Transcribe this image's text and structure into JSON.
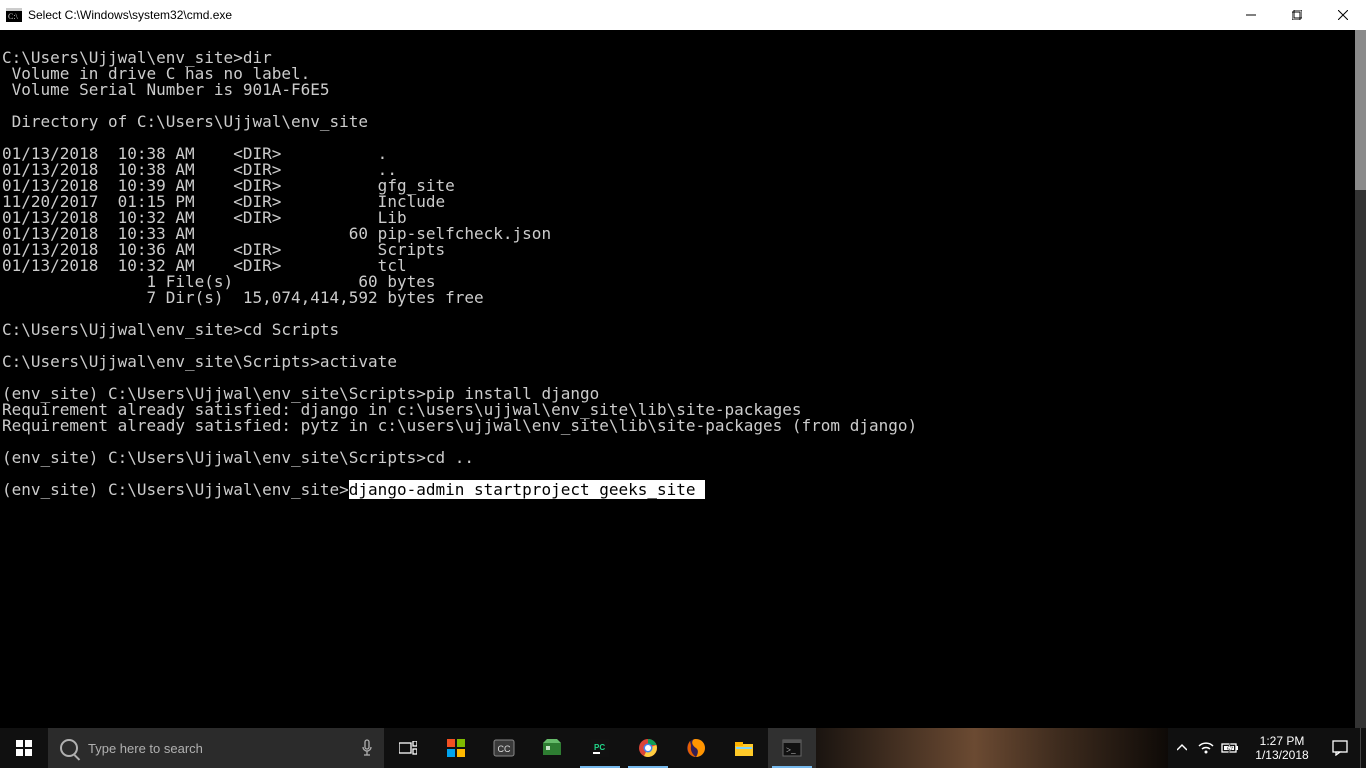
{
  "window": {
    "title": "Select C:\\Windows\\system32\\cmd.exe"
  },
  "terminal": {
    "lines": [
      "",
      "C:\\Users\\Ujjwal\\env_site>dir",
      " Volume in drive C has no label.",
      " Volume Serial Number is 901A-F6E5",
      "",
      " Directory of C:\\Users\\Ujjwal\\env_site",
      "",
      "01/13/2018  10:38 AM    <DIR>          .",
      "01/13/2018  10:38 AM    <DIR>          ..",
      "01/13/2018  10:39 AM    <DIR>          gfg_site",
      "11/20/2017  01:15 PM    <DIR>          Include",
      "01/13/2018  10:32 AM    <DIR>          Lib",
      "01/13/2018  10:33 AM                60 pip-selfcheck.json",
      "01/13/2018  10:36 AM    <DIR>          Scripts",
      "01/13/2018  10:32 AM    <DIR>          tcl",
      "               1 File(s)             60 bytes",
      "               7 Dir(s)  15,074,414,592 bytes free",
      "",
      "C:\\Users\\Ujjwal\\env_site>cd Scripts",
      "",
      "C:\\Users\\Ujjwal\\env_site\\Scripts>activate",
      "",
      "(env_site) C:\\Users\\Ujjwal\\env_site\\Scripts>pip install django",
      "Requirement already satisfied: django in c:\\users\\ujjwal\\env_site\\lib\\site-packages",
      "Requirement already satisfied: pytz in c:\\users\\ujjwal\\env_site\\lib\\site-packages (from django)",
      "",
      "(env_site) C:\\Users\\Ujjwal\\env_site\\Scripts>cd ..",
      ""
    ],
    "final_prompt": "(env_site) C:\\Users\\Ujjwal\\env_site>",
    "final_selected": "django-admin startproject geeks_site "
  },
  "taskbar": {
    "search_placeholder": "Type here to search",
    "clock_time": "1:27 PM",
    "clock_date": "1/13/2018"
  }
}
